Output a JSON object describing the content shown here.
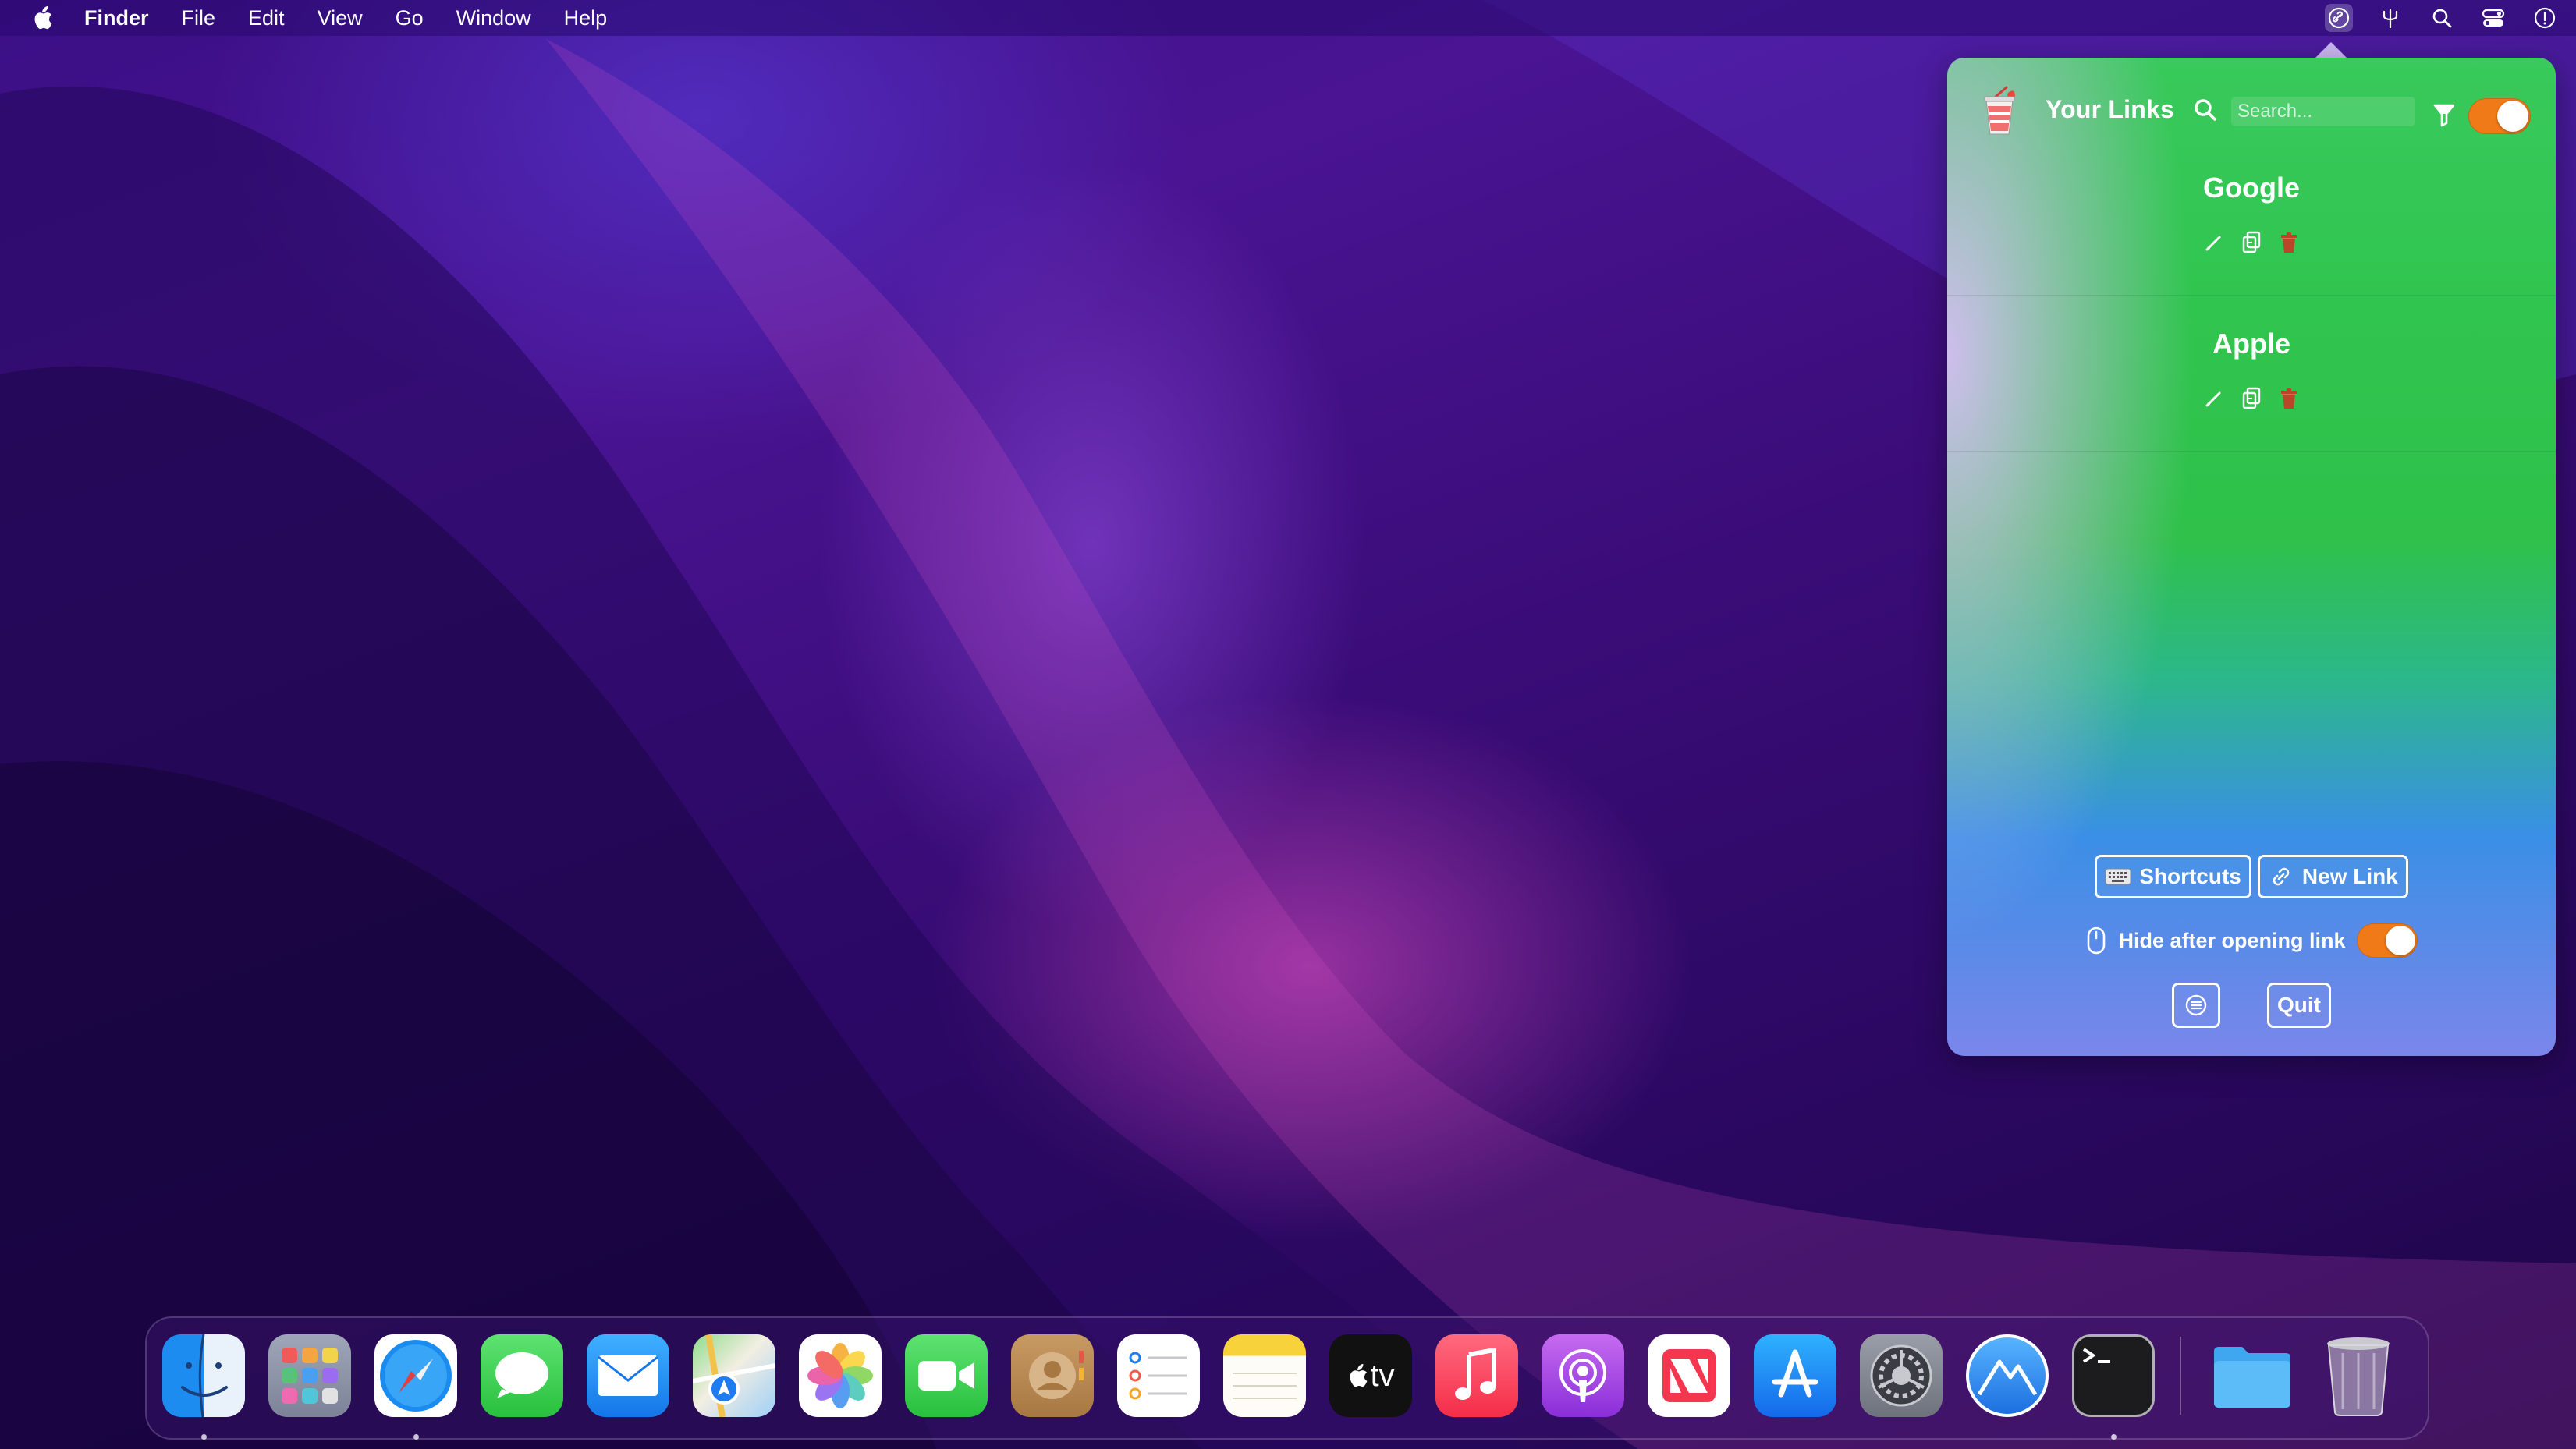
{
  "menubar": {
    "app_name": "Finder",
    "items": [
      "File",
      "Edit",
      "View",
      "Go",
      "Window",
      "Help"
    ],
    "status_icons": [
      "link-icon",
      "pitchfork-icon",
      "spotlight-icon",
      "control-center-icon",
      "siri-icon"
    ]
  },
  "popover": {
    "title": "Your Links",
    "search": {
      "placeholder": "Search...",
      "value": ""
    },
    "header_toggle_on": true,
    "links": [
      {
        "name": "Google"
      },
      {
        "name": "Apple"
      }
    ],
    "buttons": {
      "shortcuts": "Shortcuts",
      "new_link": "New Link",
      "quit": "Quit"
    },
    "hide_after_opening": {
      "label": "Hide after opening link",
      "on": true
    },
    "colors": {
      "accent_toggle": "#f07a18",
      "gradient_top": "#39c95c",
      "gradient_bottom": "#7b86ea",
      "delete_icon": "#b8472a"
    }
  },
  "dock": {
    "apps": [
      {
        "name": "Finder",
        "running": true
      },
      {
        "name": "Launchpad",
        "running": false
      },
      {
        "name": "Safari",
        "running": true
      },
      {
        "name": "Messages",
        "running": false
      },
      {
        "name": "Mail",
        "running": false
      },
      {
        "name": "Maps",
        "running": false
      },
      {
        "name": "Photos",
        "running": false
      },
      {
        "name": "FaceTime",
        "running": false
      },
      {
        "name": "Contacts",
        "running": false
      },
      {
        "name": "Reminders",
        "running": false
      },
      {
        "name": "Notes",
        "running": false
      },
      {
        "name": "TV",
        "running": false
      },
      {
        "name": "Music",
        "running": false
      },
      {
        "name": "Podcasts",
        "running": false
      },
      {
        "name": "News",
        "running": false
      },
      {
        "name": "App Store",
        "running": false
      },
      {
        "name": "System Preferences",
        "running": false
      },
      {
        "name": "Monterey Mountain",
        "running": false
      },
      {
        "name": "Terminal",
        "running": true
      }
    ],
    "tv_label": "tv",
    "extras": [
      "Downloads Folder",
      "Trash"
    ]
  }
}
